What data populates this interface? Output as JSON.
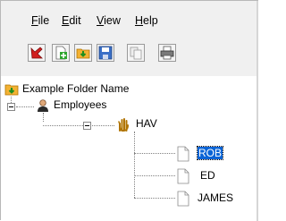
{
  "menu": {
    "file": {
      "accel": "F",
      "rest": "ile"
    },
    "edit": {
      "accel": "E",
      "rest": "dit"
    },
    "view": {
      "accel": "V",
      "rest": "iew"
    },
    "help": {
      "accel": "H",
      "rest": "elp"
    }
  },
  "toolbar": {
    "buttons": [
      "delete-icon",
      "new-file-icon",
      "open-folder-icon",
      "save-icon",
      "copy-icon",
      "print-icon"
    ]
  },
  "tree": {
    "root": {
      "label": "Example Folder Name",
      "icon": "folder-icon"
    },
    "group": {
      "label": "Employees",
      "icon": "person-icon",
      "expanded": true
    },
    "subgroup": {
      "label": "HAV",
      "icon": "hand-icon",
      "expanded": true
    },
    "items": [
      {
        "label": "ROB",
        "selected": true,
        "icon": "document-icon"
      },
      {
        "label": "ED",
        "selected": false,
        "icon": "document-icon"
      },
      {
        "label": "JAMES",
        "selected": false,
        "icon": "document-icon"
      }
    ]
  },
  "colors": {
    "selection": "#0a64d6",
    "chrome": "#f0f0f0"
  }
}
